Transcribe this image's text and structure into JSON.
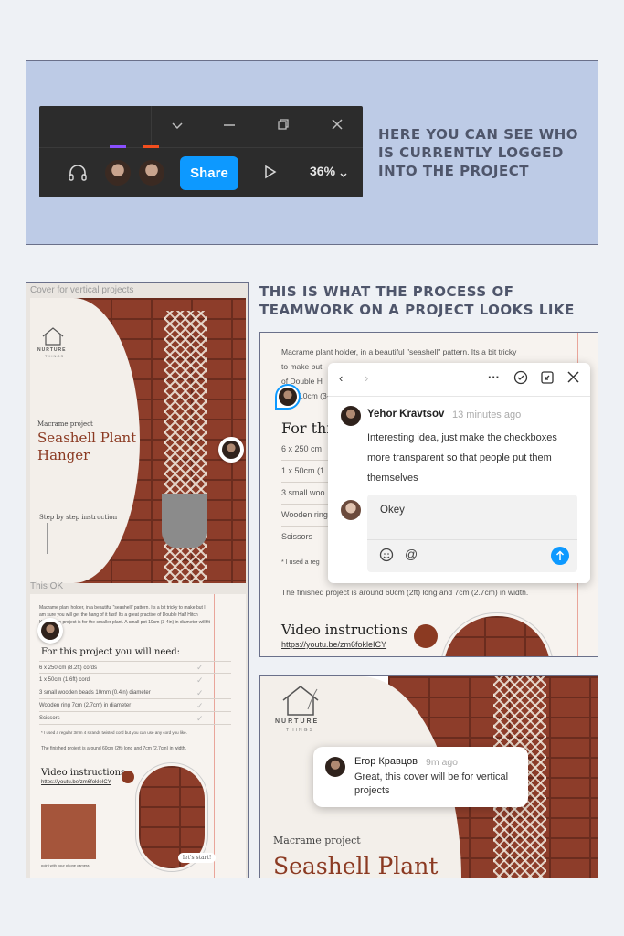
{
  "toolbar": {
    "icons": [
      "chevron-down-icon",
      "minimize-icon",
      "restore-icon",
      "close-icon",
      "headphones-icon",
      "play-icon"
    ],
    "share_label": "Share",
    "zoom": "36%",
    "avatar_colors": [
      "#8a4fff",
      "#f24e1e"
    ]
  },
  "headline_top": "HERE YOU CAN SEE WHO IS CURRENTLY LOGGED INTO THE PROJECT",
  "headline_mid": "THIS IS WHAT THE PROCESS OF TEAMWORK ON A PROJECT LOOKS LIKE",
  "left_frame": {
    "cover_label": "Cover for vertical projects",
    "brand": "NURTURE",
    "brand_sub": "THINGS",
    "subtitle": "Macrame project",
    "title": "Seashell Plant Hanger",
    "step_link": "Step by step instruction",
    "ok_label": "This OK",
    "intro": "Macrame plant holder, in a beautiful \"seashell\" pattern. Its a bit tricky to make but I am sure you will get the hang of it fast! Its a great practise of Double Half Hitch Knots. The project is for the smaller plant. A small pot 10cm (3-4in) in diameter will fit just fine!",
    "need_heading": "For this project you will need:",
    "items": [
      "6 x 250 cm (8.2ft) cords",
      "1 x 50cm (1.6ft) cord",
      "3 small wooden beads 10mm (0.4in) diameter",
      "Wooden ring 7cm (2.7cm) in diameter",
      "Scissors"
    ],
    "note": "* I used a regular 3mm 4 strands twisted cord but you can use any cord you like.",
    "finished": "The finished project is around 60cm (2ft) long and 7cm (2.7cm) in width.",
    "video_heading": "Video instructions",
    "video_link": "https://youtu.be/zm6fokleICY",
    "phone_caption": "point with your phone camera",
    "lets_start": "let's start!"
  },
  "comment_frame": {
    "intro_line1": "Macrame plant holder, in a beautiful \"seashell\" pattern. Its a bit tricky",
    "intro_line2": "to make but",
    "intro_line3": "of Double H",
    "intro_line4": "10cm (3-4",
    "for_this": "For thi",
    "items": [
      "6 x 250 cm",
      "1 x 50cm (1",
      "3 small woo",
      "Wooden ring",
      "Scissors"
    ],
    "note": "* I used a reg",
    "finished": "The finished project is around 60cm (2ft) long and 7cm (2.7cm) in width.",
    "video_heading": "Video instructions",
    "video_link": "https://youtu.be/zm6fokleICY",
    "popup": {
      "author": "Yehor Kravtsov",
      "time": "13 minutes ago",
      "message": "Interesting idea, just make the checkboxes more transparent so that people put them themselves",
      "reply": "Okey"
    }
  },
  "bottom_frame": {
    "brand": "NURTURE",
    "brand_sub": "THINGS",
    "subtitle": "Macrame project",
    "title": "Seashell Plant",
    "comment": {
      "author": "Егор Кравцов",
      "time": "9m ago",
      "message": "Great, this cover will be for vertical projects"
    }
  }
}
